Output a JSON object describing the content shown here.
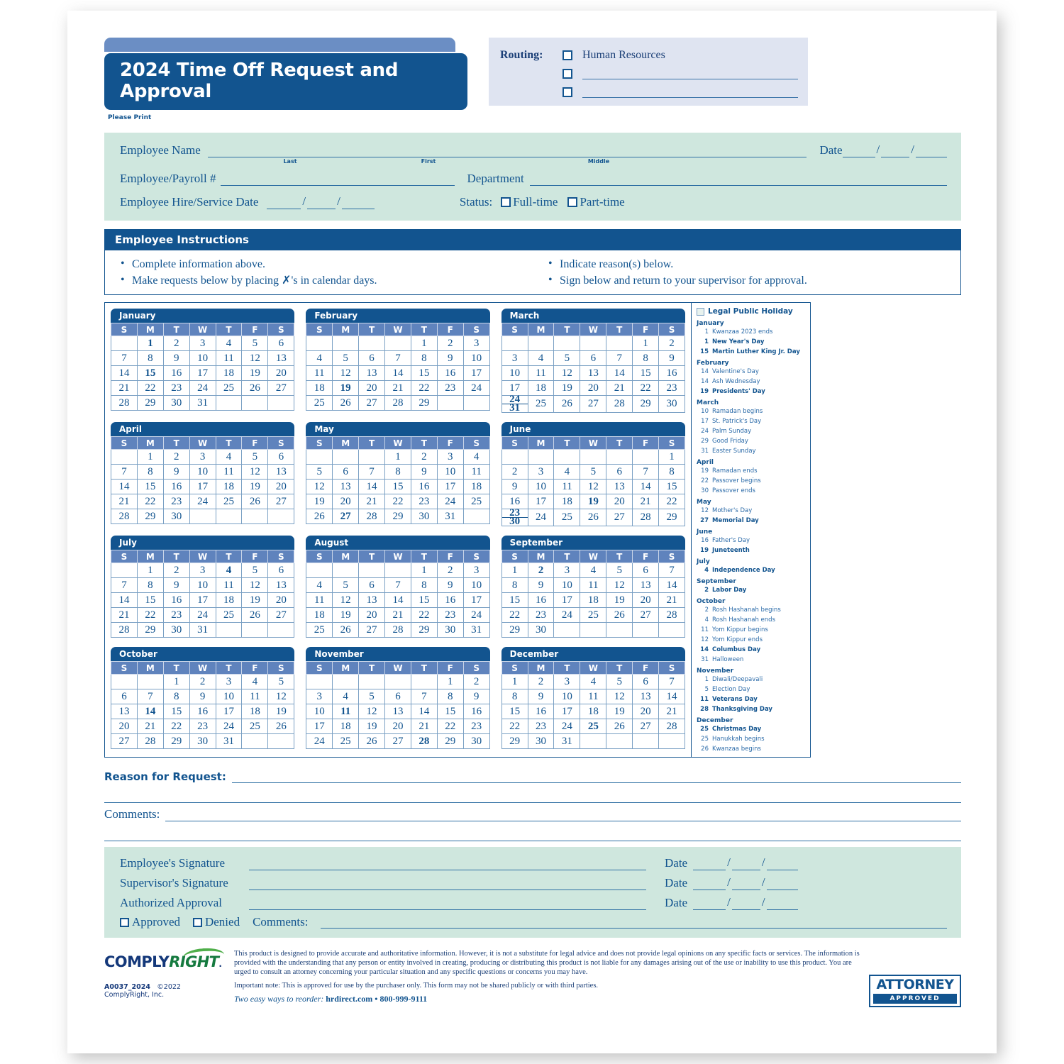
{
  "header": {
    "title": "2024 Time Off Request and Approval",
    "please_print": "Please Print",
    "routing_label": "Routing:",
    "routing_first": "Human Resources"
  },
  "employee": {
    "name_label": "Employee Name",
    "cap_last": "Last",
    "cap_first": "First",
    "cap_middle": "Middle",
    "date_label": "Date",
    "payroll_label": "Employee/Payroll #",
    "department_label": "Department",
    "hire_label": "Employee Hire/Service Date",
    "status_label": "Status:",
    "full_time": "Full-time",
    "part_time": "Part-time"
  },
  "instructions": {
    "heading": "Employee Instructions",
    "left": [
      "Complete information above.",
      "Make requests below by placing ✗'s in calendar days."
    ],
    "right": [
      "Indicate reason(s) below.",
      "Sign below and return to your supervisor for approval."
    ]
  },
  "calendar": {
    "year": 2024,
    "daynames": [
      "S",
      "M",
      "T",
      "W",
      "T",
      "F",
      "S"
    ],
    "months": [
      {
        "name": "January",
        "start": 1,
        "days": 31,
        "highlight": [
          1,
          15
        ]
      },
      {
        "name": "February",
        "start": 4,
        "days": 29,
        "highlight": [
          19
        ]
      },
      {
        "name": "March",
        "start": 5,
        "days": 31,
        "highlight": [],
        "wrap": true
      },
      {
        "name": "April",
        "start": 1,
        "days": 30,
        "highlight": []
      },
      {
        "name": "May",
        "start": 3,
        "days": 31,
        "highlight": [
          27
        ]
      },
      {
        "name": "June",
        "start": 6,
        "days": 30,
        "highlight": [
          19
        ],
        "wrap": true
      },
      {
        "name": "July",
        "start": 1,
        "days": 31,
        "highlight": [
          4
        ]
      },
      {
        "name": "August",
        "start": 4,
        "days": 31,
        "highlight": []
      },
      {
        "name": "September",
        "start": 0,
        "days": 30,
        "highlight": [
          2
        ]
      },
      {
        "name": "October",
        "start": 2,
        "days": 31,
        "highlight": [
          14
        ]
      },
      {
        "name": "November",
        "start": 5,
        "days": 30,
        "highlight": [
          11,
          28
        ]
      },
      {
        "name": "December",
        "start": 0,
        "days": 31,
        "highlight": [
          25
        ]
      }
    ]
  },
  "legend": {
    "heading": "Legal Public Holiday",
    "groups": [
      {
        "month": "January",
        "items": [
          {
            "day": "1",
            "name": "Kwanzaa 2023 ends",
            "bold": false
          },
          {
            "day": "1",
            "name": "New Year's Day",
            "bold": true
          },
          {
            "day": "15",
            "name": "Martin Luther King Jr. Day",
            "bold": true
          }
        ]
      },
      {
        "month": "February",
        "items": [
          {
            "day": "14",
            "name": "Valentine's Day",
            "bold": false
          },
          {
            "day": "14",
            "name": "Ash Wednesday",
            "bold": false
          },
          {
            "day": "19",
            "name": "Presidents' Day",
            "bold": true
          }
        ]
      },
      {
        "month": "March",
        "items": [
          {
            "day": "10",
            "name": "Ramadan begins",
            "bold": false
          },
          {
            "day": "17",
            "name": "St. Patrick's Day",
            "bold": false
          },
          {
            "day": "24",
            "name": "Palm Sunday",
            "bold": false
          },
          {
            "day": "29",
            "name": "Good Friday",
            "bold": false
          },
          {
            "day": "31",
            "name": "Easter Sunday",
            "bold": false
          }
        ]
      },
      {
        "month": "April",
        "items": [
          {
            "day": "19",
            "name": "Ramadan ends",
            "bold": false
          },
          {
            "day": "22",
            "name": "Passover begins",
            "bold": false
          },
          {
            "day": "30",
            "name": "Passover ends",
            "bold": false
          }
        ]
      },
      {
        "month": "May",
        "items": [
          {
            "day": "12",
            "name": "Mother's Day",
            "bold": false
          },
          {
            "day": "27",
            "name": "Memorial Day",
            "bold": true
          }
        ]
      },
      {
        "month": "June",
        "items": [
          {
            "day": "16",
            "name": "Father's Day",
            "bold": false
          },
          {
            "day": "19",
            "name": "Juneteenth",
            "bold": true
          }
        ]
      },
      {
        "month": "July",
        "items": [
          {
            "day": "4",
            "name": "Independence Day",
            "bold": true
          }
        ]
      },
      {
        "month": "September",
        "items": [
          {
            "day": "2",
            "name": "Labor Day",
            "bold": true
          }
        ]
      },
      {
        "month": "October",
        "items": [
          {
            "day": "2",
            "name": "Rosh Hashanah begins",
            "bold": false
          },
          {
            "day": "4",
            "name": "Rosh Hashanah ends",
            "bold": false
          },
          {
            "day": "11",
            "name": "Yom Kippur begins",
            "bold": false
          },
          {
            "day": "12",
            "name": "Yom Kippur ends",
            "bold": false
          },
          {
            "day": "14",
            "name": "Columbus Day",
            "bold": true
          },
          {
            "day": "31",
            "name": "Halloween",
            "bold": false
          }
        ]
      },
      {
        "month": "November",
        "items": [
          {
            "day": "1",
            "name": "Diwali/Deepavali",
            "bold": false
          },
          {
            "day": "5",
            "name": "Election Day",
            "bold": false
          },
          {
            "day": "11",
            "name": "Veterans Day",
            "bold": true
          },
          {
            "day": "28",
            "name": "Thanksgiving Day",
            "bold": true
          }
        ]
      },
      {
        "month": "December",
        "items": [
          {
            "day": "25",
            "name": "Christmas Day",
            "bold": true
          },
          {
            "day": "25",
            "name": "Hanukkah begins",
            "bold": false
          },
          {
            "day": "26",
            "name": "Kwanzaa begins",
            "bold": false
          }
        ]
      }
    ]
  },
  "reason": {
    "label": "Reason for Request:",
    "comments_label": "Comments:"
  },
  "signature": {
    "employee": "Employee's Signature",
    "supervisor": "Supervisor's Signature",
    "authorized": "Authorized Approval",
    "date": "Date",
    "approved": "Approved",
    "denied": "Denied",
    "comments": "Comments:"
  },
  "footer": {
    "logo_comply": "COMPLY",
    "logo_right": "RIGHT",
    "form_id": "A0037_2024",
    "copyright": "©2022 ComplyRight, Inc.",
    "disclaimer": "This product is designed to provide accurate and authoritative information. However, it is not a substitute for legal advice and does not provide legal opinions on any specific facts or services. The information is provided with the understanding that any person or entity involved in creating, producing or distributing this product is not liable for any damages arising out of the use or inability to use this product. You are urged to consult an attorney concerning your particular situation and any specific questions or concerns you may have.",
    "important_note": "Important note: This is approved for use by the purchaser only. This form may not be shared publicly or with third parties.",
    "reorder_lead": "Two easy ways to reorder:",
    "reorder_info": "hrdirect.com • 800-999-9111",
    "attorney_top": "ATTORNEY",
    "attorney_bottom": "APPROVED"
  },
  "colors": {
    "brand_blue": "#12548f",
    "header_blue": "#5f83bd",
    "mint": "#cfe7de",
    "routing_lavender": "#dfe4f1"
  }
}
